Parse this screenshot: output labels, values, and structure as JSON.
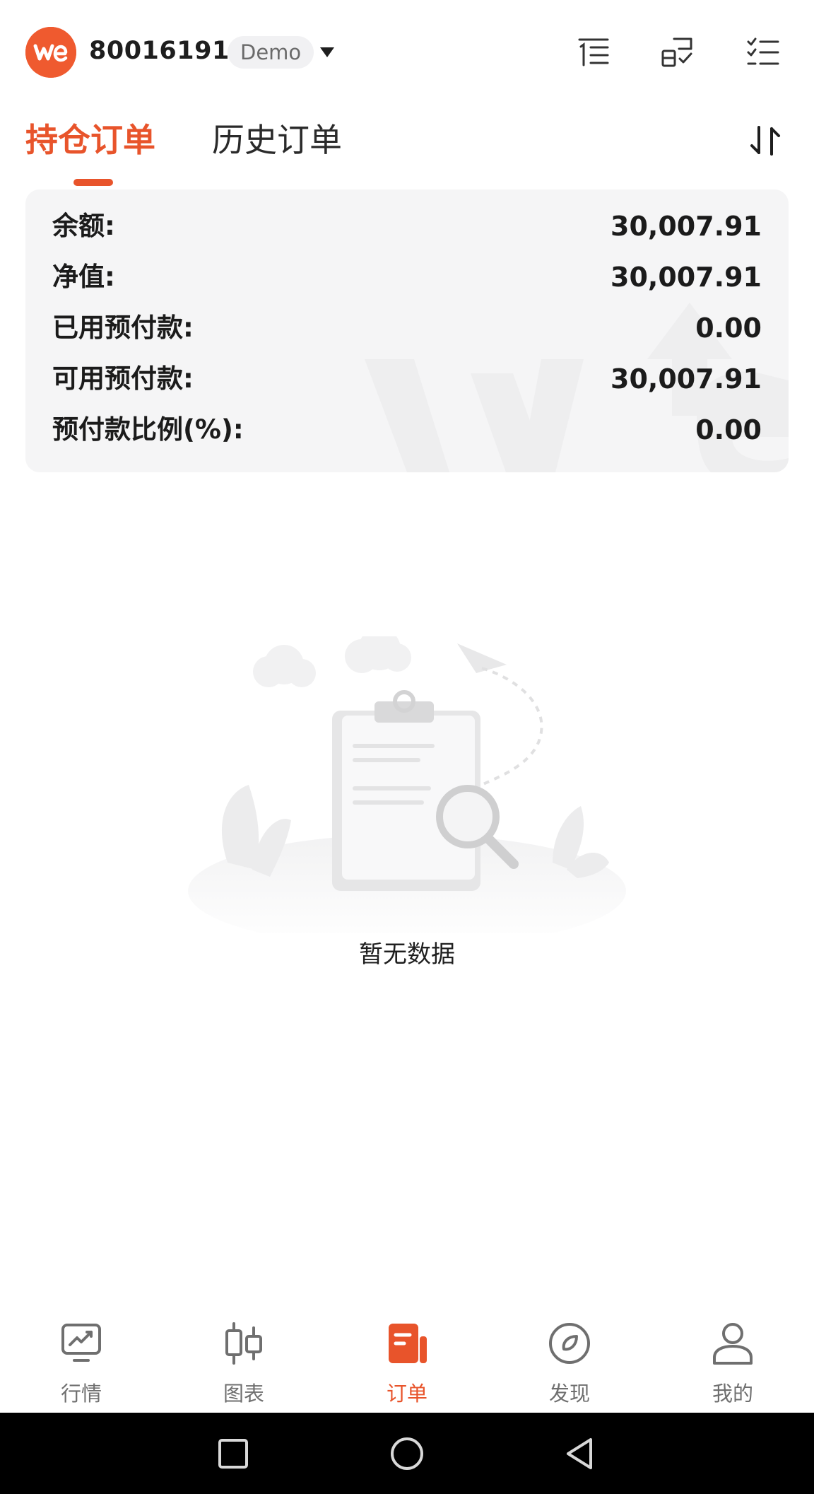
{
  "header": {
    "account_id": "800161918",
    "account_badge": "Demo",
    "logo_text": "we",
    "icons": [
      "list-indent-icon",
      "order-confirm-icon",
      "checklist-icon"
    ]
  },
  "tabs": [
    {
      "label": "持仓订单",
      "active": true
    },
    {
      "label": "历史订单",
      "active": false
    }
  ],
  "summary": {
    "rows": [
      {
        "label": "余额:",
        "value": "30,007.91"
      },
      {
        "label": "净值:",
        "value": "30,007.91"
      },
      {
        "label": "已用预付款:",
        "value": "0.00"
      },
      {
        "label": "可用预付款:",
        "value": "30,007.91"
      },
      {
        "label": "预付款比例(%):",
        "value": "0.00"
      }
    ]
  },
  "empty_state": {
    "text": "暂无数据",
    "icon": "empty-clipboard-icon"
  },
  "bottom_nav": [
    {
      "label": "行情",
      "icon": "market-chart-icon",
      "active": false
    },
    {
      "label": "图表",
      "icon": "candlestick-icon",
      "active": false
    },
    {
      "label": "订单",
      "icon": "order-icon",
      "active": true
    },
    {
      "label": "发现",
      "icon": "compass-icon",
      "active": false
    },
    {
      "label": "我的",
      "icon": "user-icon",
      "active": false
    }
  ],
  "colors": {
    "accent": "#e8542b",
    "logo": "#ef5a2f",
    "card_bg": "#f5f5f6",
    "nav_inactive": "#6f6f6f"
  }
}
